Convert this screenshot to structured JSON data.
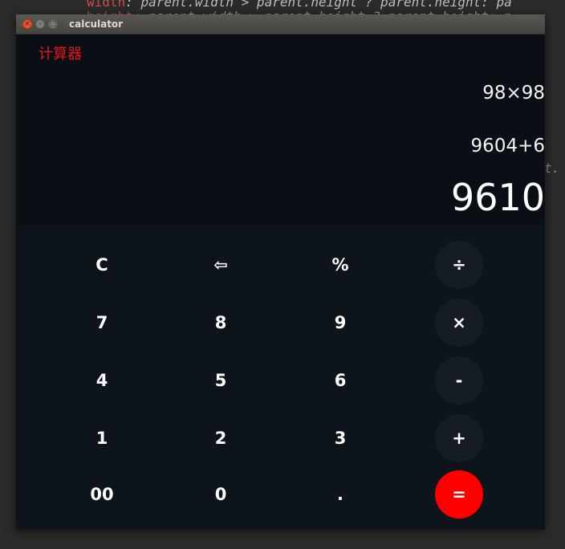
{
  "background_code": {
    "line1_kw": "width",
    "line1": ": parent.width > parent.height ? parent.height: pa",
    "line2_kw": "height",
    "line2": ": parent.width > parent.height ? parent.height: p",
    "tail": "t."
  },
  "window": {
    "title": "calculator",
    "close_glyph": "×",
    "min_glyph": "–",
    "max_glyph": "□"
  },
  "display": {
    "app_label": "计算器",
    "history": [
      "98×98",
      "9604+6"
    ],
    "result": "9610"
  },
  "keys": [
    {
      "name": "clear-key",
      "label": "C",
      "kind": "num"
    },
    {
      "name": "backspace-key",
      "label": "⇦",
      "kind": "num"
    },
    {
      "name": "percent-key",
      "label": "%",
      "kind": "num"
    },
    {
      "name": "divide-key",
      "label": "÷",
      "kind": "op"
    },
    {
      "name": "digit-7-key",
      "label": "7",
      "kind": "num"
    },
    {
      "name": "digit-8-key",
      "label": "8",
      "kind": "num"
    },
    {
      "name": "digit-9-key",
      "label": "9",
      "kind": "num"
    },
    {
      "name": "multiply-key",
      "label": "×",
      "kind": "op"
    },
    {
      "name": "digit-4-key",
      "label": "4",
      "kind": "num"
    },
    {
      "name": "digit-5-key",
      "label": "5",
      "kind": "num"
    },
    {
      "name": "digit-6-key",
      "label": "6",
      "kind": "num"
    },
    {
      "name": "minus-key",
      "label": "-",
      "kind": "op"
    },
    {
      "name": "digit-1-key",
      "label": "1",
      "kind": "num"
    },
    {
      "name": "digit-2-key",
      "label": "2",
      "kind": "num"
    },
    {
      "name": "digit-3-key",
      "label": "3",
      "kind": "num"
    },
    {
      "name": "plus-key",
      "label": "+",
      "kind": "op"
    },
    {
      "name": "double-zero-key",
      "label": "00",
      "kind": "num"
    },
    {
      "name": "digit-0-key",
      "label": "0",
      "kind": "num"
    },
    {
      "name": "decimal-point-key",
      "label": ".",
      "kind": "num"
    },
    {
      "name": "equals-key",
      "label": "=",
      "kind": "eq"
    }
  ],
  "colors": {
    "accent": "#ff0000",
    "label": "#e8161b",
    "op_key_bg": "#161c24",
    "window_bg": "#0e141b",
    "display_bg": "#0a0f16"
  }
}
